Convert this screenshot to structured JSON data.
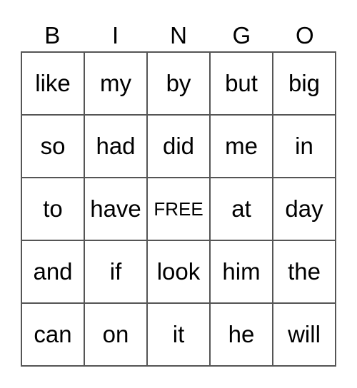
{
  "header": [
    "B",
    "I",
    "N",
    "G",
    "O"
  ],
  "cells": [
    [
      "like",
      "my",
      "by",
      "but",
      "big"
    ],
    [
      "so",
      "had",
      "did",
      "me",
      "in"
    ],
    [
      "to",
      "have",
      "FREE",
      "at",
      "day"
    ],
    [
      "and",
      "if",
      "look",
      "him",
      "the"
    ],
    [
      "can",
      "on",
      "it",
      "he",
      "will"
    ]
  ]
}
